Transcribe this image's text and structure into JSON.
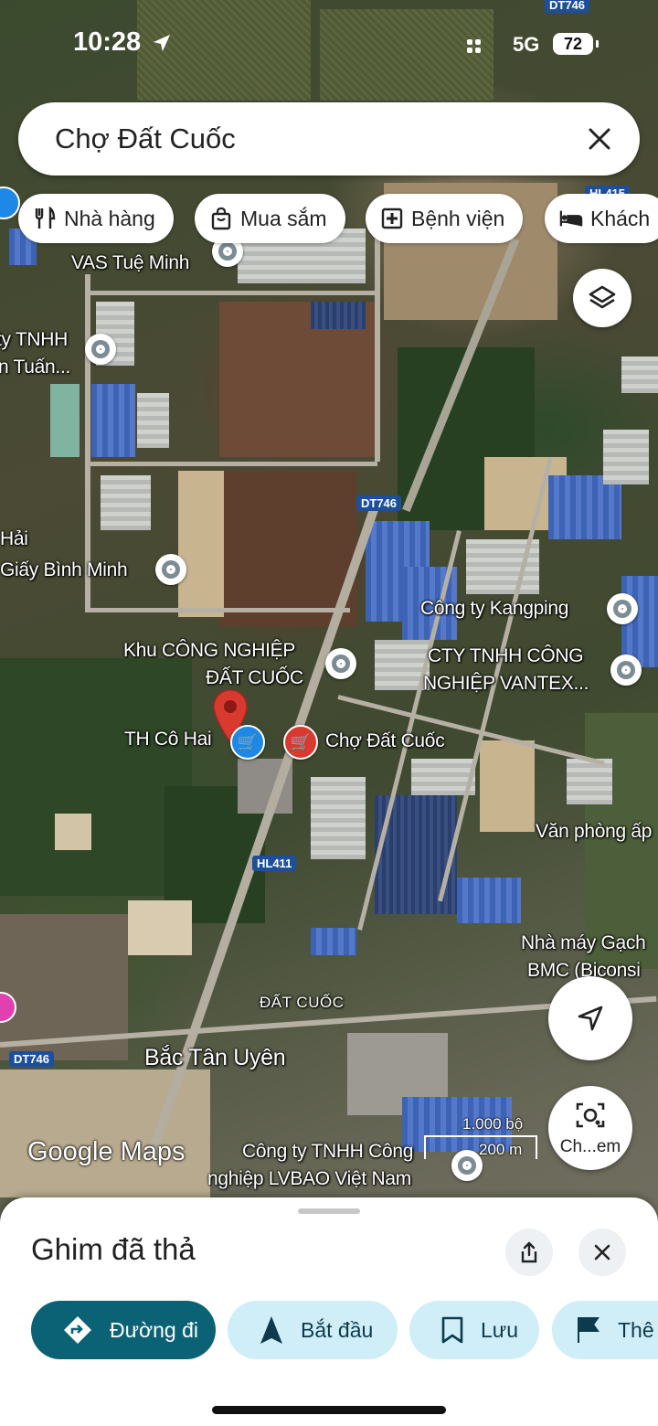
{
  "status_bar": {
    "time": "10:28",
    "network": "5G",
    "battery": "72"
  },
  "search": {
    "query": "Chợ Đất Cuốc",
    "close_icon": "close-icon"
  },
  "chips": [
    {
      "label": "Nhà hàng",
      "icon": "fork-knife-icon"
    },
    {
      "label": "Mua sắm",
      "icon": "shopping-bag-icon"
    },
    {
      "label": "Bệnh viện",
      "icon": "hospital-icon"
    },
    {
      "label": "Khách",
      "icon": "bed-icon"
    }
  ],
  "map": {
    "road_labels": [
      "DT746",
      "HL415",
      "DT746",
      "HL411",
      "DT746"
    ],
    "places": [
      "VAS Tuệ Minh",
      "ty TNHH",
      "n Tuấn...",
      "Hải",
      "Giấy Bình Minh",
      "Công ty Kangping",
      "Khu CÔNG NGHIỆP",
      "ĐẤT CUỐC",
      "CTY TNHH CÔNG",
      "NGHIỆP VANTEX...",
      "TH Cô Hai",
      "Chợ Đất Cuốc",
      "Văn phòng ấp",
      "Nhà máy Gạch",
      "BMC (Biconsi",
      "ĐẤT CUỐC",
      "Bắc Tân Uyên",
      "Công ty TNHH Công",
      "nghiệp LVBAO Việt Nam"
    ],
    "lens_label": "Ch...em",
    "google_logo": "Google Maps",
    "scale_top": "1.000 bộ",
    "scale_bottom": "200 m"
  },
  "sheet": {
    "title": "Ghim đã thả",
    "actions": [
      {
        "label": "Đường đi",
        "icon": "directions-icon"
      },
      {
        "label": "Bắt đầu",
        "icon": "navigation-arrow-icon"
      },
      {
        "label": "Lưu",
        "icon": "bookmark-icon"
      },
      {
        "label": "Thê",
        "icon": "flag-icon"
      }
    ]
  },
  "colors": {
    "accent": "#0b6274",
    "pin_red": "#d93a30",
    "shop_blue": "#1e88e5"
  }
}
